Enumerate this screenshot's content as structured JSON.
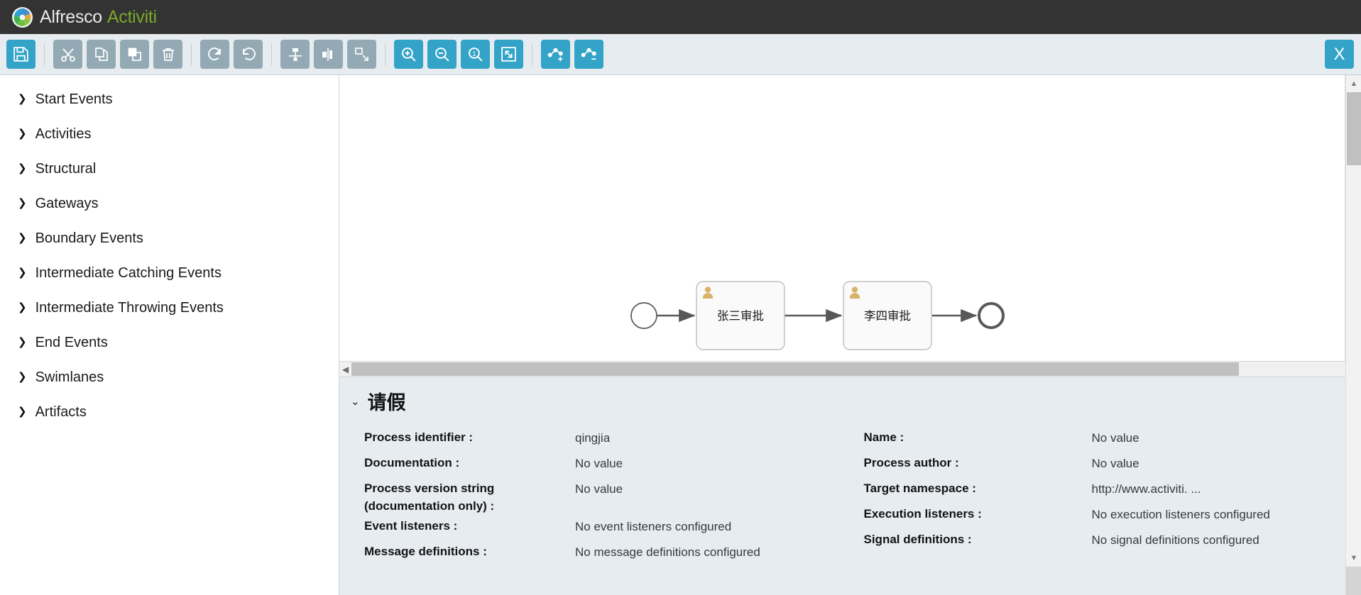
{
  "header": {
    "brand_primary": "Alfresco",
    "brand_secondary": "Activiti",
    "logo_icon": "alfresco-flower-logo",
    "bg_color": "#333333",
    "accent_color": "#7aa82a"
  },
  "toolbar": {
    "accent_blue": "#33a3c7",
    "muted_grey": "#93aab4",
    "background": "#e7ecf0",
    "buttons": [
      {
        "name": "save-button",
        "icon": "save-floppy-icon",
        "style": "blue",
        "label": "Save"
      },
      {
        "name": "cut-button",
        "icon": "scissors-icon",
        "style": "grey",
        "label": "Cut"
      },
      {
        "name": "copy-button",
        "icon": "copy-icon",
        "style": "grey",
        "label": "Copy"
      },
      {
        "name": "paste-button",
        "icon": "paste-icon",
        "style": "grey",
        "label": "Paste"
      },
      {
        "name": "delete-button",
        "icon": "trash-icon",
        "style": "grey",
        "label": "Delete"
      },
      {
        "name": "redo-button",
        "icon": "redo-arrow-icon",
        "style": "grey",
        "label": "Redo"
      },
      {
        "name": "undo-button",
        "icon": "undo-arrow-icon",
        "style": "grey",
        "label": "Undo"
      },
      {
        "name": "align-vertical-button",
        "icon": "align-vertical-icon",
        "style": "grey",
        "label": "Align vertical"
      },
      {
        "name": "align-horizontal-button",
        "icon": "align-horizontal-icon",
        "style": "grey",
        "label": "Align horizontal"
      },
      {
        "name": "same-size-button",
        "icon": "resize-same-size-icon",
        "style": "grey",
        "label": "Same size"
      },
      {
        "name": "zoom-in-button",
        "icon": "zoom-in-icon",
        "style": "blue",
        "label": "Zoom in"
      },
      {
        "name": "zoom-out-button",
        "icon": "zoom-out-icon",
        "style": "blue",
        "label": "Zoom out"
      },
      {
        "name": "zoom-actual-button",
        "icon": "zoom-actual-size-icon",
        "style": "blue",
        "label": "Zoom actual"
      },
      {
        "name": "zoom-fit-button",
        "icon": "zoom-fit-icon",
        "style": "blue",
        "label": "Zoom fit"
      },
      {
        "name": "add-bendpoint-button",
        "icon": "add-bendpoint-icon",
        "style": "blue",
        "label": "Add bend-point"
      },
      {
        "name": "remove-bendpoint-button",
        "icon": "remove-bendpoint-icon",
        "style": "blue",
        "label": "Remove bend-point"
      }
    ],
    "close_label": "X"
  },
  "palette": {
    "items": [
      {
        "label": "Start Events"
      },
      {
        "label": "Activities"
      },
      {
        "label": "Structural"
      },
      {
        "label": "Gateways"
      },
      {
        "label": "Boundary Events"
      },
      {
        "label": "Intermediate Catching Events"
      },
      {
        "label": "Intermediate Throwing Events"
      },
      {
        "label": "End Events"
      },
      {
        "label": "Swimlanes"
      },
      {
        "label": "Artifacts"
      }
    ]
  },
  "canvas": {
    "nodes": [
      {
        "type": "start-event",
        "label": ""
      },
      {
        "type": "user-task",
        "label": "张三审批"
      },
      {
        "type": "user-task",
        "label": "李四审批"
      },
      {
        "type": "end-event",
        "label": ""
      }
    ],
    "shape_fill": "#fafafa",
    "shape_stroke": "#bfbfbf",
    "connector_color": "#585858",
    "task_icon": "user-task-person-icon"
  },
  "properties": {
    "title": "请假",
    "expanded": true,
    "left_column": [
      {
        "label": "Process identifier :",
        "value": "qingjia"
      },
      {
        "label": "Documentation :",
        "value": "No value"
      },
      {
        "label": "Process version string (documentation only) :",
        "value": "No value"
      },
      {
        "label": "Event listeners :",
        "value": "No event listeners configured"
      },
      {
        "label": "Message definitions :",
        "value": "No message definitions configured"
      }
    ],
    "right_column": [
      {
        "label": "Name :",
        "value": "No value"
      },
      {
        "label": "Process author :",
        "value": "No value"
      },
      {
        "label": "Target namespace :",
        "value": "http://www.activiti. ..."
      },
      {
        "label": "Execution listeners :",
        "value": "No execution listeners configured"
      },
      {
        "label": "Signal definitions :",
        "value": "No signal definitions configured"
      }
    ]
  },
  "scroll": {
    "left_arrow": "◀",
    "right_arrow": "▶",
    "up_arrow": "▲",
    "down_arrow": "▼"
  }
}
